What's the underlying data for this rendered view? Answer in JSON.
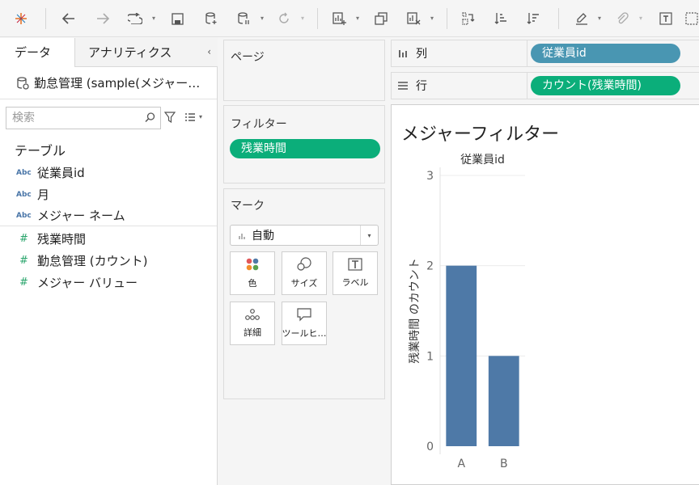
{
  "left_panel": {
    "tab_data": "データ",
    "tab_analytics": "アナリティクス",
    "datasource": "勤怠管理 (sample(メジャー…",
    "search_placeholder": "検索",
    "section_title": "テーブル",
    "fields": [
      {
        "type_label": "Abc",
        "name": "従業員id",
        "kind": "dimension"
      },
      {
        "type_label": "Abc",
        "name": "月",
        "kind": "dimension"
      },
      {
        "type_label": "Abc",
        "name": "メジャー ネーム",
        "kind": "dimension"
      },
      {
        "type_label": "#",
        "name": "残業時間",
        "kind": "measure"
      },
      {
        "type_label": "#",
        "name": "勤怠管理 (カウント)",
        "kind": "measure"
      },
      {
        "type_label": "#",
        "name": "メジャー バリュー",
        "kind": "measure"
      }
    ]
  },
  "cards": {
    "pages_title": "ページ",
    "filters_title": "フィルター",
    "filter_pill": "残業時間",
    "marks_title": "マーク",
    "mark_type": "自動",
    "mark_buttons": [
      "色",
      "サイズ",
      "ラベル",
      "詳細",
      "ツールヒ…"
    ]
  },
  "shelves": {
    "columns_label": "列",
    "columns_pill": "従業員id",
    "rows_label": "行",
    "rows_pill": "カウント(残業時間)"
  },
  "colors": {
    "dimension_pill": "#4996b2",
    "measure_pill": "#0bae7a",
    "bar": "#4e79a7"
  },
  "chart_data": {
    "type": "bar",
    "title": "メジャーフィルター",
    "column_header": "従業員id",
    "ylabel": "残業時間 のカウント",
    "categories": [
      "A",
      "B"
    ],
    "values": [
      2,
      1
    ],
    "ylim": [
      0,
      3
    ],
    "yticks": [
      0,
      1,
      2,
      3
    ],
    "grid": true
  }
}
